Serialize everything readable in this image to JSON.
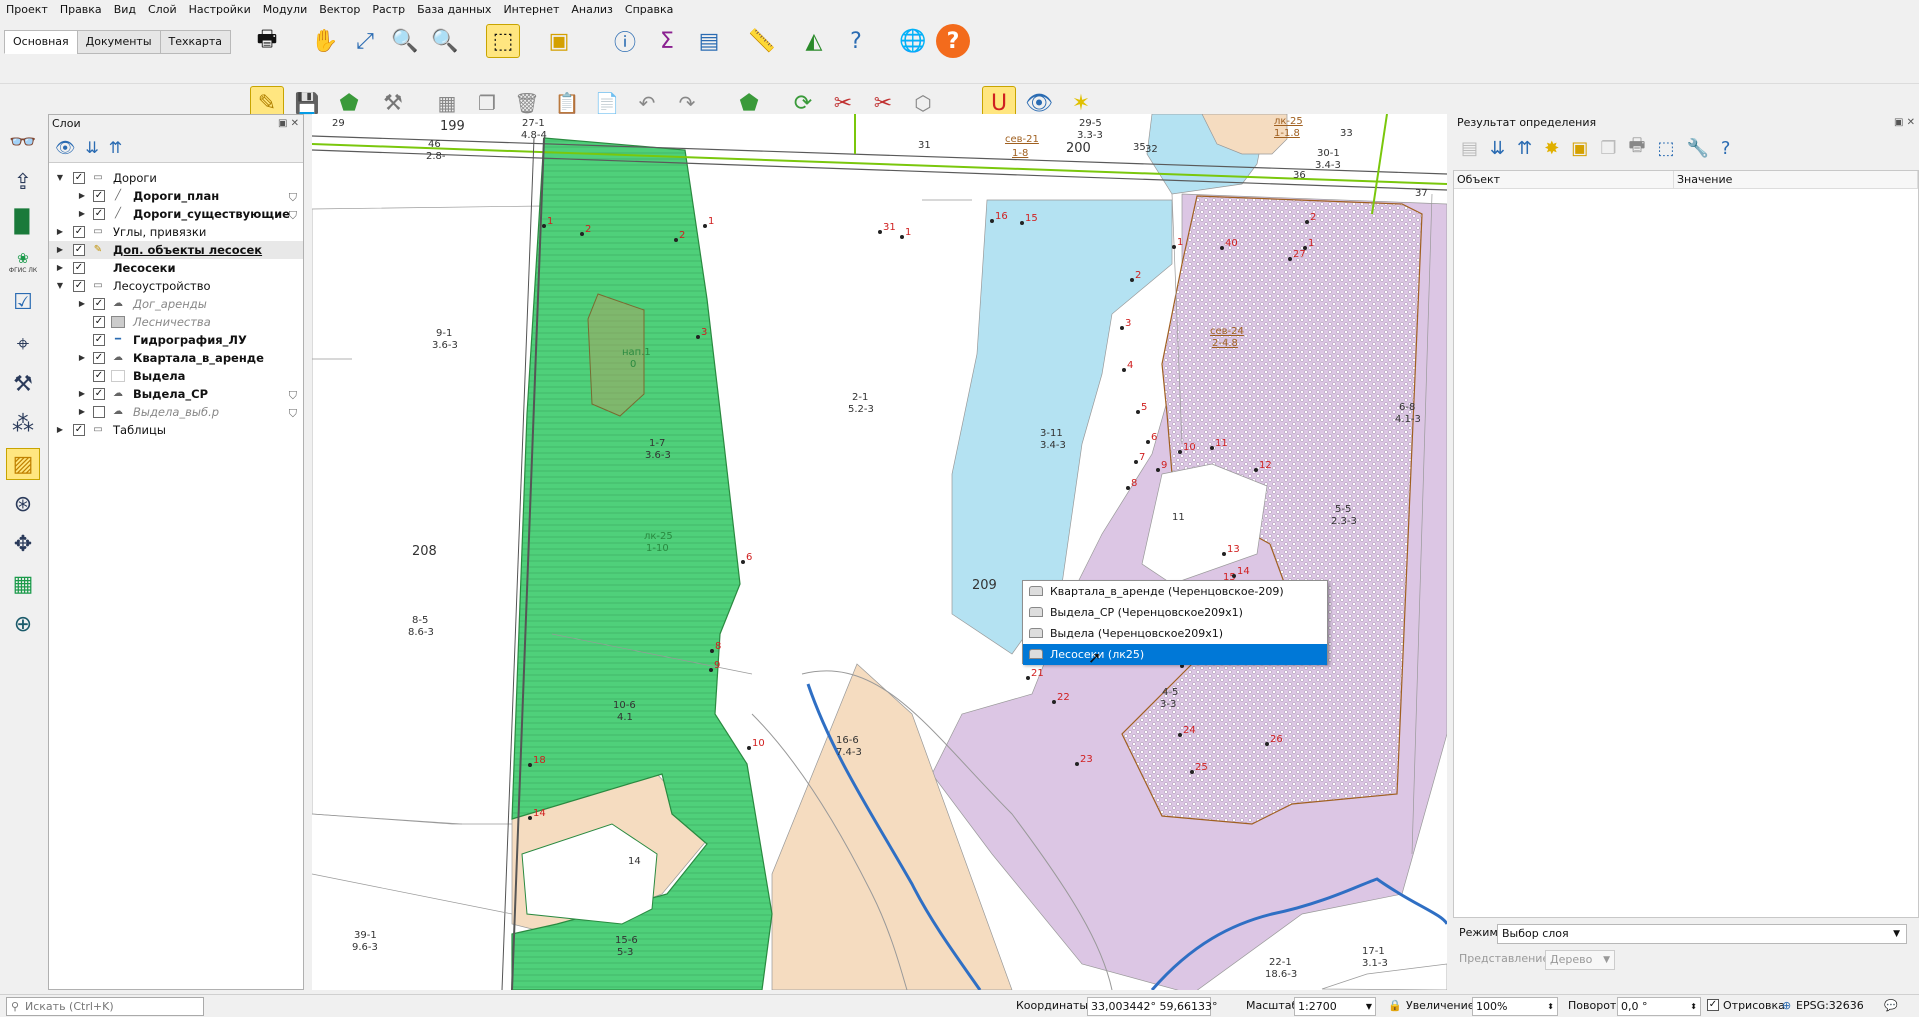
{
  "menu": [
    "Проект",
    "Правка",
    "Вид",
    "Слой",
    "Настройки",
    "Модули",
    "Вектор",
    "Растр",
    "База данных",
    "Интернет",
    "Анализ",
    "Справка"
  ],
  "tabs": [
    "Основная",
    "Документы",
    "Техкарта"
  ],
  "layers_panel": {
    "title": "Слои",
    "items": [
      {
        "label": "Дороги",
        "style": "normal"
      },
      {
        "label": "Дороги_план",
        "style": "bold"
      },
      {
        "label": "Дороги_существующие",
        "style": "bold"
      },
      {
        "label": "Углы, привязки",
        "style": "normal"
      },
      {
        "label": "Доп. объекты лесосек",
        "style": "bold-underline"
      },
      {
        "label": "Лесосеки",
        "style": "bold"
      },
      {
        "label": "Лесоустройство",
        "style": "normal"
      },
      {
        "label": "Дог_аренды",
        "style": "italic"
      },
      {
        "label": "Лесничества",
        "style": "italic"
      },
      {
        "label": "Гидрография_ЛУ",
        "style": "bold"
      },
      {
        "label": "Квартала_в_аренде",
        "style": "bold"
      },
      {
        "label": "Выдела",
        "style": "bold"
      },
      {
        "label": "Выдела_СР",
        "style": "bold"
      },
      {
        "label": "Выдела_выб.р",
        "style": "italic"
      },
      {
        "label": "Таблицы",
        "style": "normal"
      }
    ]
  },
  "left_toolbar": {
    "fgis_label": "ФГИС ЛК"
  },
  "context_menu": {
    "items": [
      "Квартала_в_аренде (Черенцовское-209)",
      "Выдела_СР (Черенцовское209x1)",
      "Выдела (Черенцовское209x1)",
      "Лесосеки (лк25)"
    ],
    "selected_index": 3
  },
  "map_labels": {
    "quarters": [
      "199",
      "200",
      "208",
      "209"
    ],
    "plots": [
      {
        "id": "29"
      },
      {
        "id": "27-1",
        "sub": "4.8-4"
      },
      {
        "id": "46",
        "sub": "2.8-"
      },
      {
        "id": "31"
      },
      {
        "id": "29-5",
        "sub": "3.3-3"
      },
      {
        "id": "32"
      },
      {
        "id": "35"
      },
      {
        "id": "37"
      },
      {
        "id": "30-1",
        "sub": "3.4-3"
      },
      {
        "id": "33"
      },
      {
        "id": "36"
      },
      {
        "id": "9-1",
        "sub": "3.6-3"
      },
      {
        "id": "2-1",
        "sub": "5.2-3"
      },
      {
        "id": "3-11",
        "sub": "3.4-3"
      },
      {
        "id": "6-8",
        "sub": "4.1-3"
      },
      {
        "id": "5-5",
        "sub": "2.3-3"
      },
      {
        "id": "11"
      },
      {
        "id": "8-5",
        "sub": "8.6-3"
      },
      {
        "id": "16-6",
        "sub": "7.4-3"
      },
      {
        "id": "14"
      },
      {
        "id": "39-1",
        "sub": "9.6-3"
      },
      {
        "id": "22-1",
        "sub": "18.6-3"
      },
      {
        "id": "17-1",
        "sub": "3.1-3"
      },
      {
        "id": "1-7",
        "sub": "3.6-3"
      },
      {
        "id": "10-6",
        "sub": "4.1"
      },
      {
        "id": "4-5",
        "sub": "3-3"
      },
      {
        "id": "15-6",
        "sub": "5-3"
      }
    ],
    "cutting_areas": [
      {
        "id": "лк-25",
        "sub": "1-10"
      },
      {
        "id": "сев-24",
        "sub": "2-4.8"
      },
      {
        "id": "сев-21",
        "sub": "1-8"
      },
      {
        "id": "лк-25",
        "sub": "1-1.8"
      },
      {
        "id": "нап.1",
        "sub": "0"
      }
    ]
  },
  "result_panel": {
    "title": "Результат определения",
    "col_object": "Объект",
    "col_value": "Значение",
    "mode_label": "Режим",
    "mode_value": "Выбор слоя",
    "view_label": "Представление",
    "view_value": "Дерево"
  },
  "status_bar": {
    "search_placeholder": "Искать (Ctrl+K)",
    "coords_label": "Координаты",
    "coords_value": "33,003442° 59,66133°",
    "scale_label": "Масштаб",
    "scale_value": "1:2700",
    "zoom_label": "Увеличение",
    "zoom_value": "100%",
    "rotation_label": "Поворот",
    "rotation_value": "0,0 °",
    "render_label": "Отрисовка",
    "crs": "EPSG:32636"
  },
  "colors": {
    "selection": "#0078d7",
    "cutting_fill": "#4fd07a",
    "water": "#b4e2f2",
    "lease": "#dcc6e4",
    "sand": "#f5dcc0",
    "road_green": "#7ac70c",
    "river": "#2f6fc4",
    "vertex_red": "#d02020"
  },
  "icons": [
    "print-icon",
    "pan-icon",
    "zoom-full-icon",
    "zoom-layer-icon",
    "zoom-selection-icon",
    "select-icon",
    "deselect-icon",
    "identify-icon",
    "statistics-icon",
    "attribute-table-icon",
    "measure-icon",
    "tip-icon",
    "help-icon",
    "globe-icon",
    "pencil-icon",
    "snap-magnet-icon",
    "eye-icon"
  ]
}
